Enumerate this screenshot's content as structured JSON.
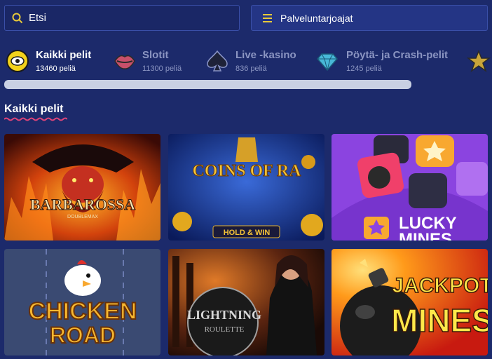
{
  "search": {
    "placeholder": "Etsi"
  },
  "providers": {
    "label": "Palveluntarjoajat"
  },
  "categories": [
    {
      "title": "Kaikki pelit",
      "count": "13460 peliä",
      "icon": "all-games-icon",
      "active": true
    },
    {
      "title": "Slotit",
      "count": "11300 peliä",
      "icon": "lips-icon"
    },
    {
      "title": "Live -kasino",
      "count": "836 peliä",
      "icon": "spade-icon"
    },
    {
      "title": "Pöytä- ja Crash-pelit",
      "count": "1245 peliä",
      "icon": "diamond-icon"
    },
    {
      "title": "",
      "count": "",
      "icon": "star-icon"
    }
  ],
  "section": {
    "title": "Kaikki pelit"
  },
  "games": [
    {
      "name": "Barbarossa",
      "subtitle": "DOUBLEMAX"
    },
    {
      "name": "Coins of Ra",
      "subtitle": "HOLD & WIN"
    },
    {
      "name": "Lucky Mines",
      "line1": "LUCKY",
      "line2": "MINES"
    },
    {
      "name": "Chicken Road",
      "line1": "CHICKEN",
      "line2": "ROAD"
    },
    {
      "name": "Lightning Roulette",
      "line1": "LIGHTNING",
      "line2": "ROULETTE"
    },
    {
      "name": "Jackpot Mines",
      "line1": "JACKPOT",
      "line2": "MINES"
    }
  ],
  "colors": {
    "background": "#1c2a6b",
    "accent": "#e8c93a",
    "underline": "#e0447a"
  }
}
